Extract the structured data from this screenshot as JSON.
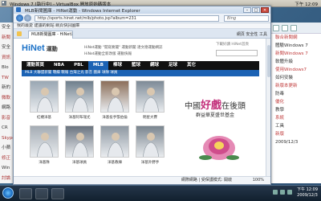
{
  "host": {
    "title": "Windows 7 [執行中] - VirtualBox 開放原始碼版本",
    "clock": "下午 12:09"
  },
  "ie": {
    "title": "MLB新聞圖庫 - HiNet運動 - Windows Internet Explorer",
    "url": "http://sports.hinet.net/mlb/photo.jsp?album=231",
    "search_placeholder": "Bing",
    "menu": "我的最愛  建議的網站  網頁快訊圖庫",
    "tab_label": "MLB新聞圖庫 - HiNet運動",
    "tools": "網頁  安全性  工具",
    "status": "網際網路 | 受保護模式: 開啟",
    "zoom": "100%"
  },
  "site": {
    "logo": "HiNet",
    "logo_sub": "運動",
    "head_links": "HiNet運動  \"開寫要聞\"  運動新聞  達文德運動網誌",
    "head_tag": "HiNet運動全新改版  運動快報",
    "head_right": "下載好讀  HiNet首頁",
    "nav": [
      "運動首頁",
      "NBA",
      "PBL",
      "MLB",
      "棒球",
      "籃球",
      "網球",
      "足球",
      "其它"
    ],
    "nav_active": 3,
    "sub_nav": "MLB  大聯盟新聞  戰績  戰報  台灣之光  影音  圖庫  球隊  球員",
    "photos": [
      {
        "caption": "紅襪洋基"
      },
      {
        "caption": "洋基阿布瑞尤"
      },
      {
        "caption": "洋基投手張伯倫"
      },
      {
        "caption": "明星大賽"
      },
      {
        "caption": "洋基隊"
      },
      {
        "caption": "洋基球員"
      },
      {
        "caption": "洋基教練"
      },
      {
        "caption": "洋基外野手"
      }
    ]
  },
  "ad": {
    "line1_pre": "中國",
    "line1_hl": "好戲",
    "line1_post": "在後頭",
    "line2": "群益華夏盛世基金"
  },
  "left_win": [
    "安全",
    "新聞",
    "安全",
    "資訊",
    "Blo",
    "TW",
    "新的",
    "微軟",
    "網路",
    "影音",
    "CR",
    "Skype",
    "小蘋",
    "修正",
    "Win",
    "討論"
  ],
  "right_win": [
    "聯合新聞網",
    "體驗Windows 7",
    "新聞Windows 7",
    "軟體升級",
    "使用Windows7",
    "如何安裝",
    "新版本更新",
    "防毒",
    "優化",
    "教學",
    "系統",
    "工具",
    "新版",
    "2009/12/3"
  ],
  "taskbar": {
    "clock_time": "下午 12:09",
    "clock_date": "2009/12/3"
  }
}
